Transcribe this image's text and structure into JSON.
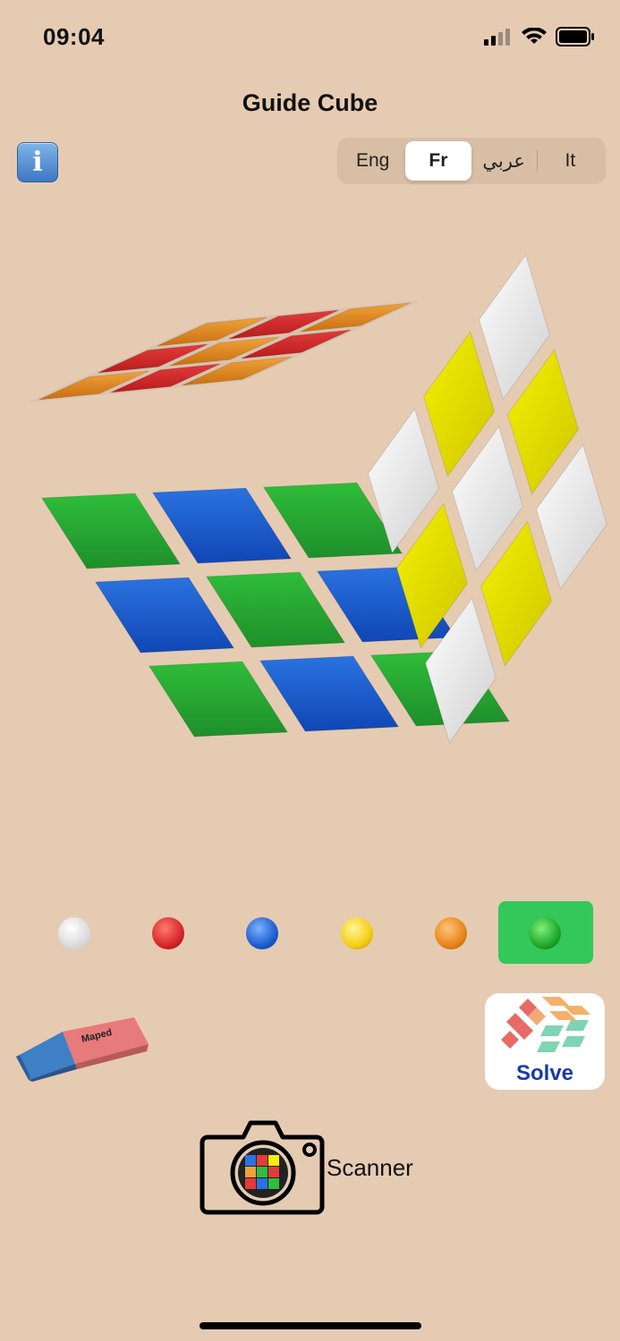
{
  "status_bar": {
    "time": "09:04"
  },
  "header": {
    "title": "Guide Cube"
  },
  "languages": [
    "Eng",
    "Fr",
    "عربي",
    "It"
  ],
  "selected_language": "Fr",
  "colors": {
    "white": "#e6e6e6",
    "red": "#d8262a",
    "blue": "#1c5fd0",
    "yellow": "#f4cf12",
    "orange": "#e7861a",
    "green": "#1faa2a",
    "selected_bg": "#34c759"
  },
  "palette": [
    "white",
    "red",
    "blue",
    "yellow",
    "orange",
    "green"
  ],
  "selected_color": "green",
  "solve_button": {
    "label": "Solve"
  },
  "scanner": {
    "label": "Scanner"
  },
  "icons": [
    "info-icon",
    "eraser-icon",
    "solve-icon",
    "camera-icon",
    "signal-icon",
    "wifi-icon",
    "battery-icon"
  ]
}
